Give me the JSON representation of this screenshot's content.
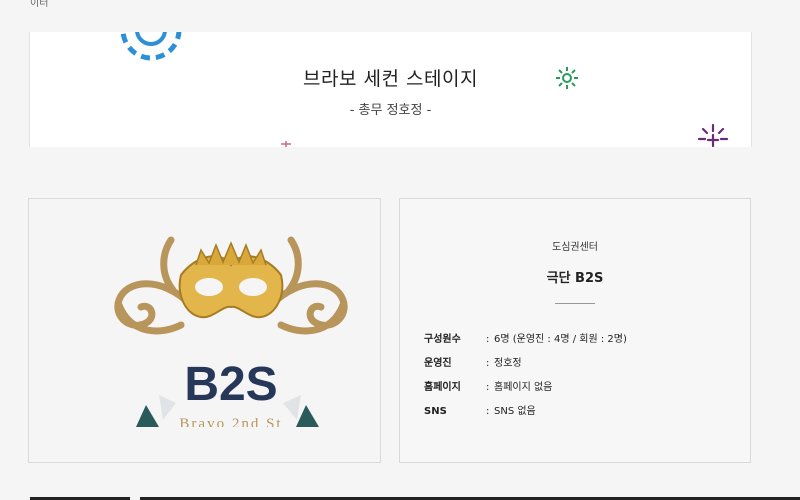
{
  "top": {
    "cut_text": "이터"
  },
  "banner": {
    "title": "브라보 세컨 스테이지",
    "subtitle": "- 총무 정호정 -",
    "deco_colors": {
      "blue": "#2d8fd6",
      "green": "#2a9a5a",
      "purple": "#6b2a7a",
      "pink": "#c86a8a"
    }
  },
  "logo": {
    "text": "B2S",
    "subtext": "Bravo 2nd St",
    "gold": "#b8955a",
    "navy": "#27375a"
  },
  "info": {
    "category": "도심권센터",
    "name": "극단 B2S",
    "rows": [
      {
        "label": "구성원수",
        "value": "6명 (운영진 : 4명 / 회원 : 2명)"
      },
      {
        "label": "운영진",
        "value": "정호정"
      },
      {
        "label": "홈페이지",
        "value": "홈페이지 없음"
      },
      {
        "label": "SNS",
        "value": "SNS 없음"
      }
    ]
  }
}
